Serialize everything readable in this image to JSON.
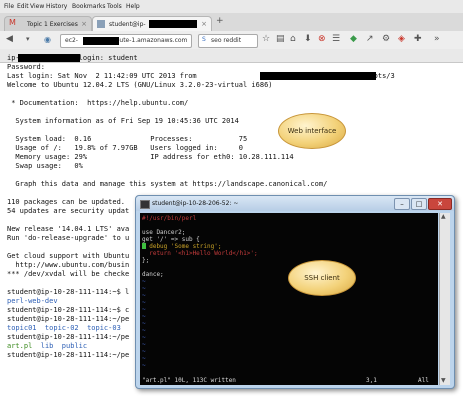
{
  "browser": {
    "menu": [
      "File",
      "Edit",
      "View",
      "History",
      "Bookmarks",
      "Tools",
      "Help"
    ],
    "tabs": [
      {
        "label": "Topic 1 Exercises",
        "active": false
      },
      {
        "label": "student@ip-",
        "active": true
      }
    ],
    "new_tab": "+",
    "url": "ec2-            .compute-1.amazonaws.com",
    "search": "seo reddit",
    "accent": "#d9532c"
  },
  "terminal": {
    "lines": [
      {
        "t": "ip-              login: student"
      },
      {
        "t": "Password:"
      },
      {
        "t": "Last login: Sat Nov  2 11:42:09 UTC 2013 from                            fast.co.uk on pts/3"
      },
      {
        "t": "Welcome to Ubuntu 12.04.2 LTS (GNU/Linux 3.2.0-23-virtual i686)"
      },
      {
        "t": ""
      },
      {
        "t": " * Documentation:  https://help.ubuntu.com/"
      },
      {
        "t": ""
      },
      {
        "t": "  System information as of Fri Sep 19 10:45:36 UTC 2014"
      },
      {
        "t": ""
      },
      {
        "t": "  System load:  0.16              Processes:           75"
      },
      {
        "t": "  Usage of /:   19.8% of 7.97GB   Users logged in:     0"
      },
      {
        "t": "  Memory usage: 29%               IP address for eth0: 10.28.111.114"
      },
      {
        "t": "  Swap usage:   0%"
      },
      {
        "t": ""
      },
      {
        "t": "  Graph this data and manage this system at https://landscape.canonical.com/"
      },
      {
        "t": ""
      },
      {
        "t": "110 packages can be updated."
      },
      {
        "t": "54 updates are security updat"
      },
      {
        "t": ""
      },
      {
        "t": "New release '14.04.1 LTS' ava"
      },
      {
        "t": "Run 'do-release-upgrade' to u"
      },
      {
        "t": ""
      },
      {
        "t": "Get cloud support with Ubuntu"
      },
      {
        "t": "  http://www.ubuntu.com/busin"
      },
      {
        "t": "*** /dev/xvdal will be checke"
      },
      {
        "t": ""
      },
      {
        "t": "student@ip-10-28-111-114:~$ l"
      },
      {
        "t": "perl-web-dev",
        "c": "blue"
      },
      {
        "t": "student@ip-10-28-111-114:~$ c"
      },
      {
        "t": "student@ip-10-28-111-114:~/pe"
      },
      {
        "t": "topic01  topic-02  topic-03",
        "c": "blue"
      },
      {
        "t": "student@ip-10-28-111-114:~/pe"
      },
      {
        "t": "art.pl  lib  public",
        "c": "mix"
      },
      {
        "t": "student@ip-10-28-111-114:~/pe"
      }
    ]
  },
  "callouts": {
    "web": "Web interface",
    "ssh": "SSH client"
  },
  "ssh_window": {
    "title": "student@ip-10-28-206-52: ~",
    "buttons": [
      "–",
      "□",
      "✕"
    ],
    "code": [
      {
        "t": "#!/usr/bin/perl",
        "c": "#c23b3b"
      },
      {
        "t": ""
      },
      {
        "t": "use Dancer2;",
        "c": "#d0d0d0"
      },
      {
        "t": "get '/' => sub {",
        "c": "#d0d0d0"
      },
      {
        "t": "  debug 'Some string';",
        "c": "#c9a227"
      },
      {
        "t": "  return '<h1>Hello World</h1>';",
        "c": "#c23b3b"
      },
      {
        "t": "};",
        "c": "#d0d0d0"
      },
      {
        "t": ""
      },
      {
        "t": "dance;",
        "c": "#d0d0d0"
      }
    ],
    "status_left": "\"art.pl\" 10L, 113C written",
    "status_pos": "3,1",
    "status_right": "All"
  }
}
